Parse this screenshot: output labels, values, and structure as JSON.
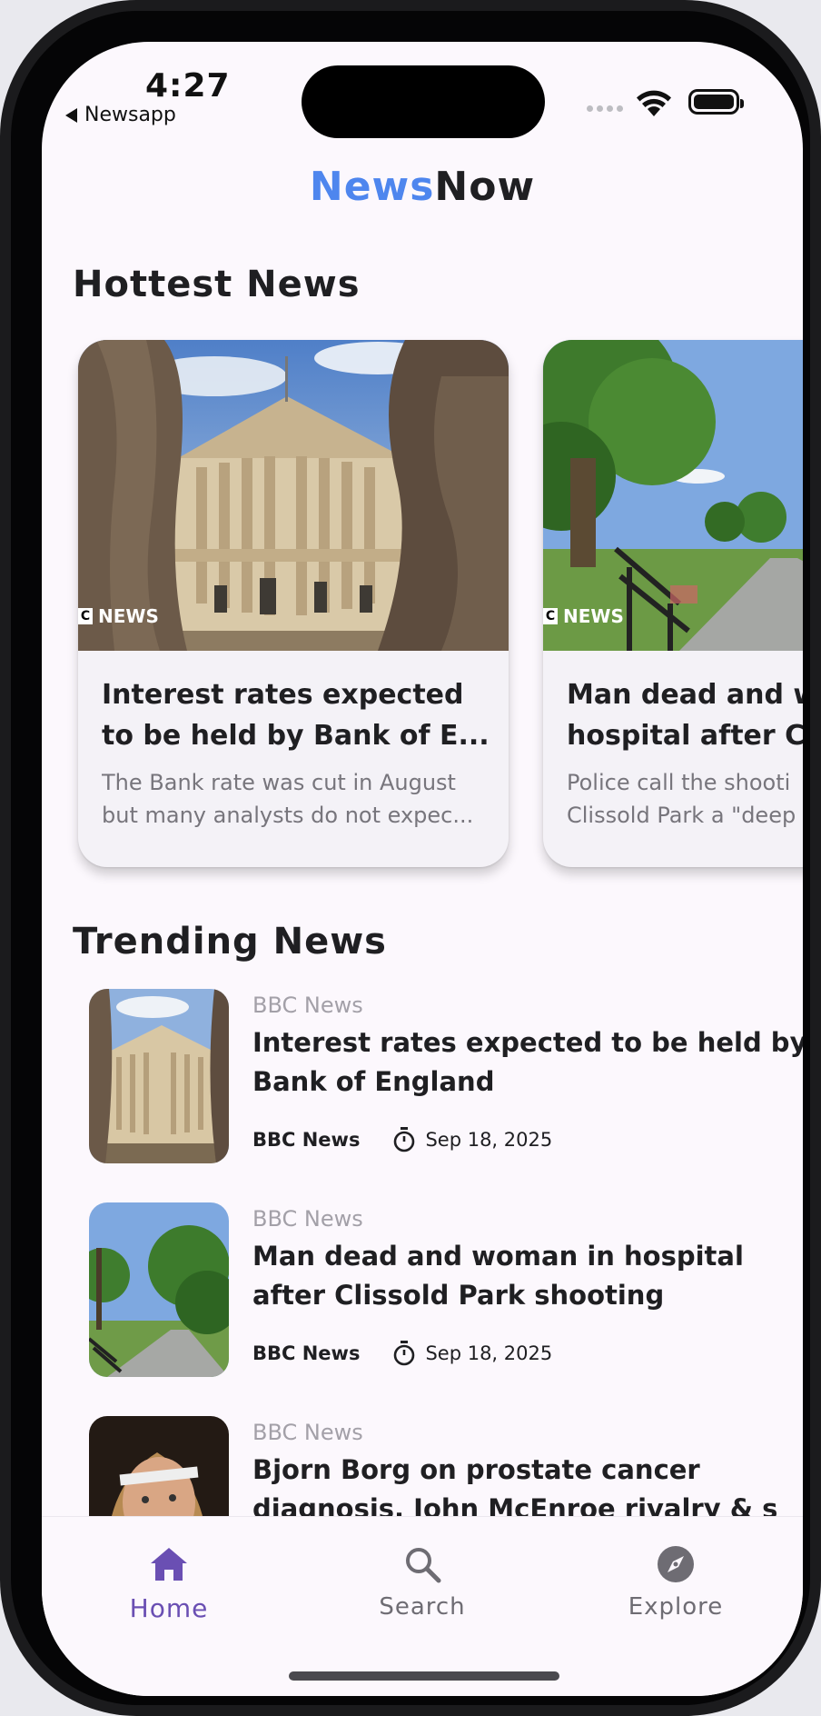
{
  "status_bar": {
    "time": "4:27",
    "back_app": "Newsapp"
  },
  "header": {
    "title_part1": "News",
    "title_part2": "Now",
    "brand_color": "#4e86ee"
  },
  "hottest": {
    "title": "Hottest News",
    "cards": [
      {
        "badge": "NEWS",
        "title_line1": "Interest rates expected",
        "title_line2": "to be held by Bank of E...",
        "desc_line1": "The Bank rate was cut in August",
        "desc_line2": "but many analysts do not expec..."
      },
      {
        "badge": "NEWS",
        "title_line1": "Man dead and w",
        "title_line2": "hospital after Cl",
        "desc_line1": "Police call the shooti",
        "desc_line2": "Clissold Park a \"deep"
      }
    ]
  },
  "trending": {
    "title": "Trending News",
    "items": [
      {
        "source": "BBC News",
        "title_line1": "Interest rates expected to be held by",
        "title_line2": "Bank of England",
        "meta_source": "BBC News",
        "date": "Sep 18, 2025"
      },
      {
        "source": "BBC News",
        "title_line1": "Man dead and woman in hospital",
        "title_line2": "after Clissold Park shooting",
        "meta_source": "BBC News",
        "date": "Sep 18, 2025"
      },
      {
        "source": "BBC News",
        "title_line1": "Bjorn Borg on prostate cancer",
        "title_line2": "diagnosis, John McEnroe rivalry & s",
        "meta_source": "",
        "date": ""
      }
    ]
  },
  "bottom_nav": {
    "active_color": "#6a4fb3",
    "items": [
      {
        "label": "Home",
        "icon": "home-icon"
      },
      {
        "label": "Search",
        "icon": "search-icon"
      },
      {
        "label": "Explore",
        "icon": "compass-icon"
      }
    ]
  }
}
